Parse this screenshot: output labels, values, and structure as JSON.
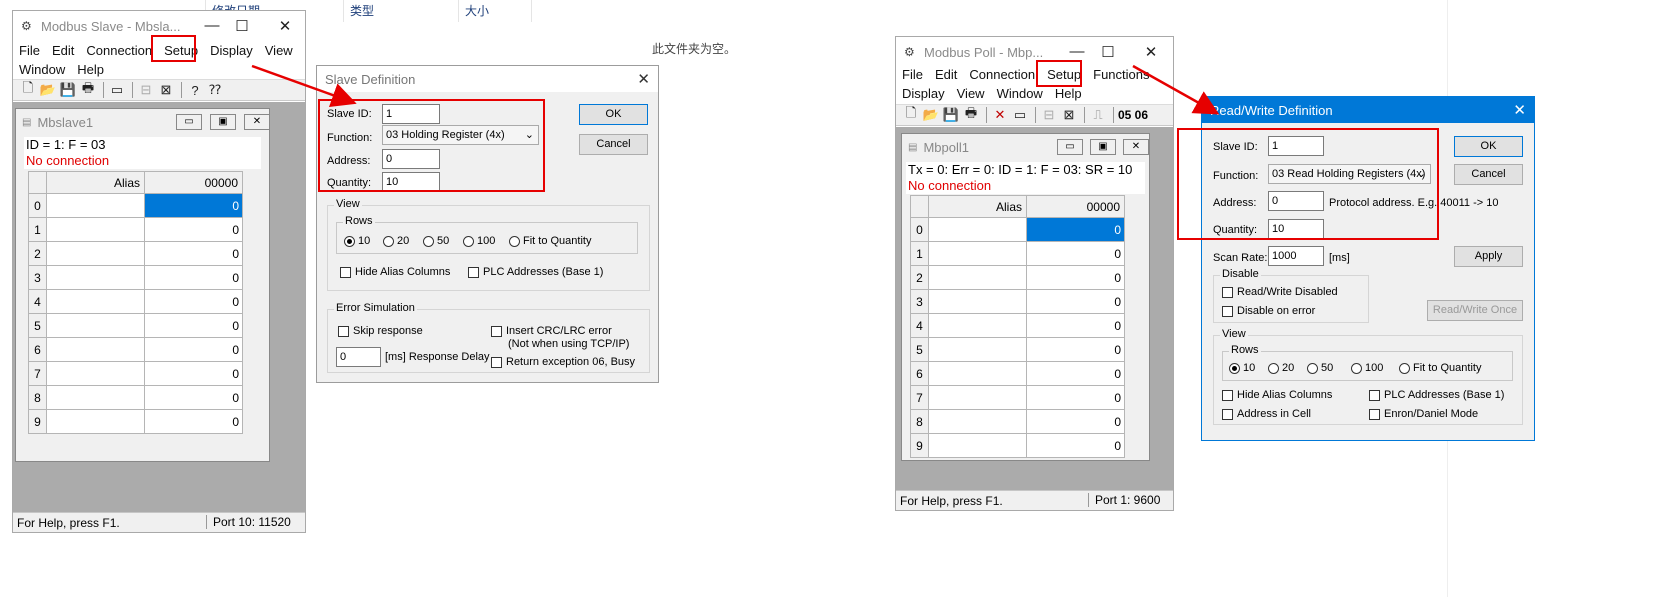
{
  "background": {
    "columns": [
      "修改日期",
      "类型",
      "大小"
    ],
    "empty_message": "此文件夹为空。"
  },
  "slave": {
    "title": "Modbus Slave - Mbsla...",
    "menu": [
      "File",
      "Edit",
      "Connection",
      "Setup",
      "Display",
      "View",
      "Window",
      "Help"
    ],
    "child_title": "Mbslave1",
    "info_line": "ID = 1: F = 03",
    "status_line": "No connection",
    "grid": {
      "alias_header": "Alias",
      "value_header": "00000",
      "rows": [
        "0",
        "1",
        "2",
        "3",
        "4",
        "5",
        "6",
        "7",
        "8",
        "9"
      ],
      "values": [
        "0",
        "0",
        "0",
        "0",
        "0",
        "0",
        "0",
        "0",
        "0",
        "0"
      ]
    },
    "statusbar": "For Help, press F1.",
    "port": "Port 10: 11520"
  },
  "slave_dialog": {
    "title": "Slave Definition",
    "slave_id_label": "Slave ID:",
    "slave_id": "1",
    "function_label": "Function:",
    "function": "03 Holding Register (4x)",
    "address_label": "Address:",
    "address": "0",
    "quantity_label": "Quantity:",
    "quantity": "10",
    "ok": "OK",
    "cancel": "Cancel",
    "view_group": "View",
    "rows_group": "Rows",
    "rows_options": [
      "10",
      "20",
      "50",
      "100",
      "Fit to Quantity"
    ],
    "hide_alias": "Hide Alias Columns",
    "plc_addresses": "PLC Addresses (Base 1)",
    "error_group": "Error Simulation",
    "skip_response": "Skip response",
    "crc_error": "Insert CRC/LRC error",
    "crc_note": "(Not when using TCP/IP)",
    "delay_value": "0",
    "delay_label": "[ms] Response Delay",
    "exception": "Return exception 06, Busy"
  },
  "poll": {
    "title": "Modbus Poll - Mbp...",
    "menu": [
      "File",
      "Edit",
      "Connection",
      "Setup",
      "Functions",
      "Display",
      "View",
      "Window",
      "Help"
    ],
    "toolbar_codes": "05 06",
    "child_title": "Mbpoll1",
    "info_line": "Tx = 0: Err = 0: ID = 1: F = 03: SR = 10",
    "status_line": "No connection",
    "grid": {
      "alias_header": "Alias",
      "value_header": "00000",
      "rows": [
        "0",
        "1",
        "2",
        "3",
        "4",
        "5",
        "6",
        "7",
        "8",
        "9"
      ],
      "values": [
        "0",
        "0",
        "0",
        "0",
        "0",
        "0",
        "0",
        "0",
        "0",
        "0"
      ]
    },
    "statusbar": "For Help, press F1.",
    "port": "Port 1: 9600"
  },
  "poll_dialog": {
    "title": "Read/Write Definition",
    "slave_id_label": "Slave ID:",
    "slave_id": "1",
    "function_label": "Function:",
    "function": "03 Read Holding Registers (4x)",
    "address_label": "Address:",
    "address": "0",
    "address_note": "Protocol address. E.g. 40011 -> 10",
    "quantity_label": "Quantity:",
    "quantity": "10",
    "scan_rate_label": "Scan Rate:",
    "scan_rate": "1000",
    "scan_unit": "[ms]",
    "ok": "OK",
    "cancel": "Cancel",
    "apply": "Apply",
    "disable_group": "Disable",
    "rw_disabled": "Read/Write Disabled",
    "disable_on_error": "Disable on error",
    "rw_once": "Read/Write Once",
    "view_group": "View",
    "rows_group": "Rows",
    "rows_options": [
      "10",
      "20",
      "50",
      "100",
      "Fit to Quantity"
    ],
    "hide_alias": "Hide Alias Columns",
    "plc_addresses": "PLC Addresses (Base 1)",
    "address_in_cell": "Address in Cell",
    "enron": "Enron/Daniel Mode"
  },
  "colors": {
    "highlight": "#e60000",
    "selection": "#0078d7",
    "client_bg": "#ababab"
  }
}
